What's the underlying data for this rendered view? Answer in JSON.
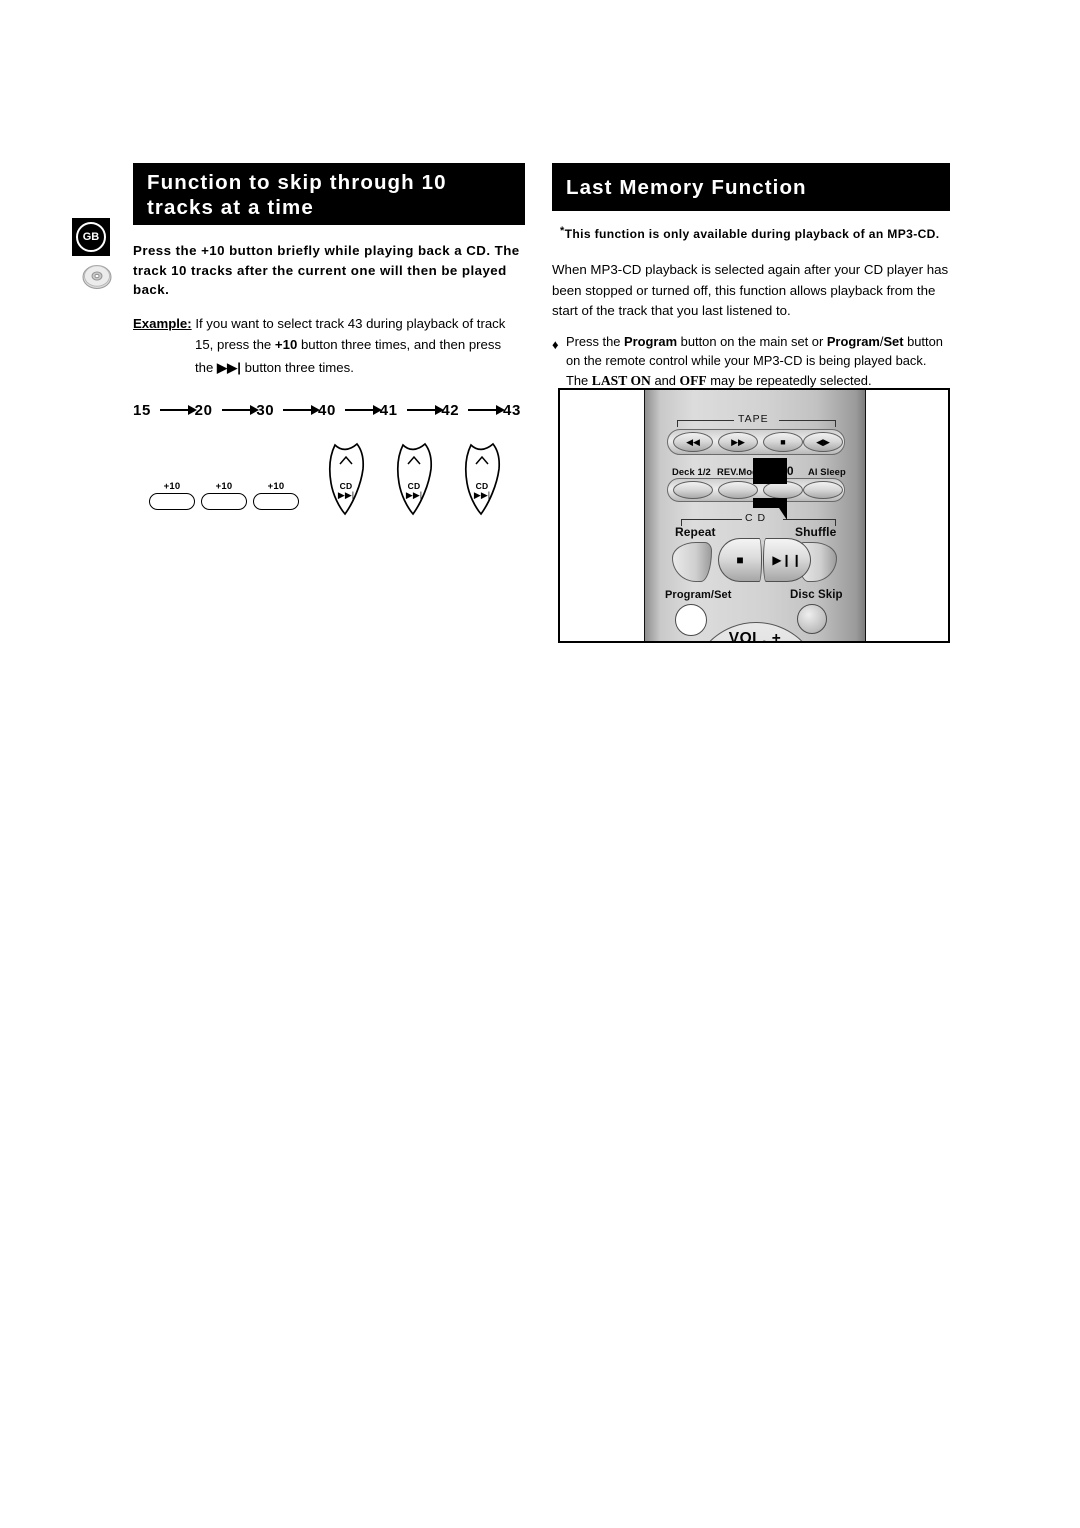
{
  "page": {
    "language_badge": "GB",
    "disc_icon": "cd-disc-icon"
  },
  "left_column": {
    "heading": "Function to skip through 10 tracks at a time",
    "intro": "Press the +10 button briefly while playing back a CD. The track 10 tracks after the current one will then be played back.",
    "example": {
      "label": "Example:",
      "line1": "If you want to select track 43 during playback of track",
      "line2_a": "15, press the ",
      "line2_b": "+10",
      "line2_c": " button three times, and then press",
      "line3_a": "the ",
      "line3_b": "▶▶|",
      "line3_c": " button three times."
    },
    "track_sequence": [
      "15",
      "20",
      "30",
      "40",
      "41",
      "42",
      "43"
    ],
    "button_diagram": {
      "plus10_buttons": [
        "+10",
        "+10",
        "+10"
      ],
      "cd_skip_buttons": [
        {
          "caret": "˄",
          "cd": "CD",
          "skip": "▶▶|"
        },
        {
          "caret": "˄",
          "cd": "CD",
          "skip": "▶▶|"
        },
        {
          "caret": "˄",
          "cd": "CD",
          "skip": "▶▶|"
        }
      ]
    }
  },
  "right_column": {
    "heading": "Last Memory Function",
    "note_star": "*",
    "note": "This function is only available during playback of an MP3-CD.",
    "body": "When MP3-CD playback is selected again after your CD player has been stopped or turned off, this function allows playback from the start of the track that you last listened to.",
    "bullet": {
      "marker": "♦",
      "line1_a": "Press the ",
      "line1_b": "Program",
      "line1_c": " button on the main set or ",
      "line1_d": "Program",
      "line1_e": "/",
      "line1_f": "Set",
      "line1_g": " button",
      "line2": "on the remote control while your MP3-CD is being played back.",
      "line3_a": "The ",
      "line3_b": "LAST ON",
      "line3_c": " and ",
      "line3_d": "OFF",
      "line3_e": " may be repeatedly selected."
    }
  },
  "remote_figure": {
    "tape_group_label": "TAPE",
    "cd_group_label": "C D",
    "tape_buttons": [
      {
        "name": "rewind",
        "glyph": "◀◀"
      },
      {
        "name": "fast-forward",
        "glyph": "▶▶"
      },
      {
        "name": "stop",
        "glyph": "■"
      },
      {
        "name": "direction",
        "glyph": "◀▶"
      }
    ],
    "function_buttons": [
      "Deck 1/2",
      "REV.Mode",
      "+10",
      "Al Sleep"
    ],
    "repeat_label": "Repeat",
    "shuffle_label": "Shuffle",
    "cd_stop_glyph": "■",
    "cd_play_pause_glyph": "▶❙❙",
    "program_set_label": "Program/Set",
    "disc_skip_label": "Disc Skip",
    "vol_label": "VOL. +"
  }
}
